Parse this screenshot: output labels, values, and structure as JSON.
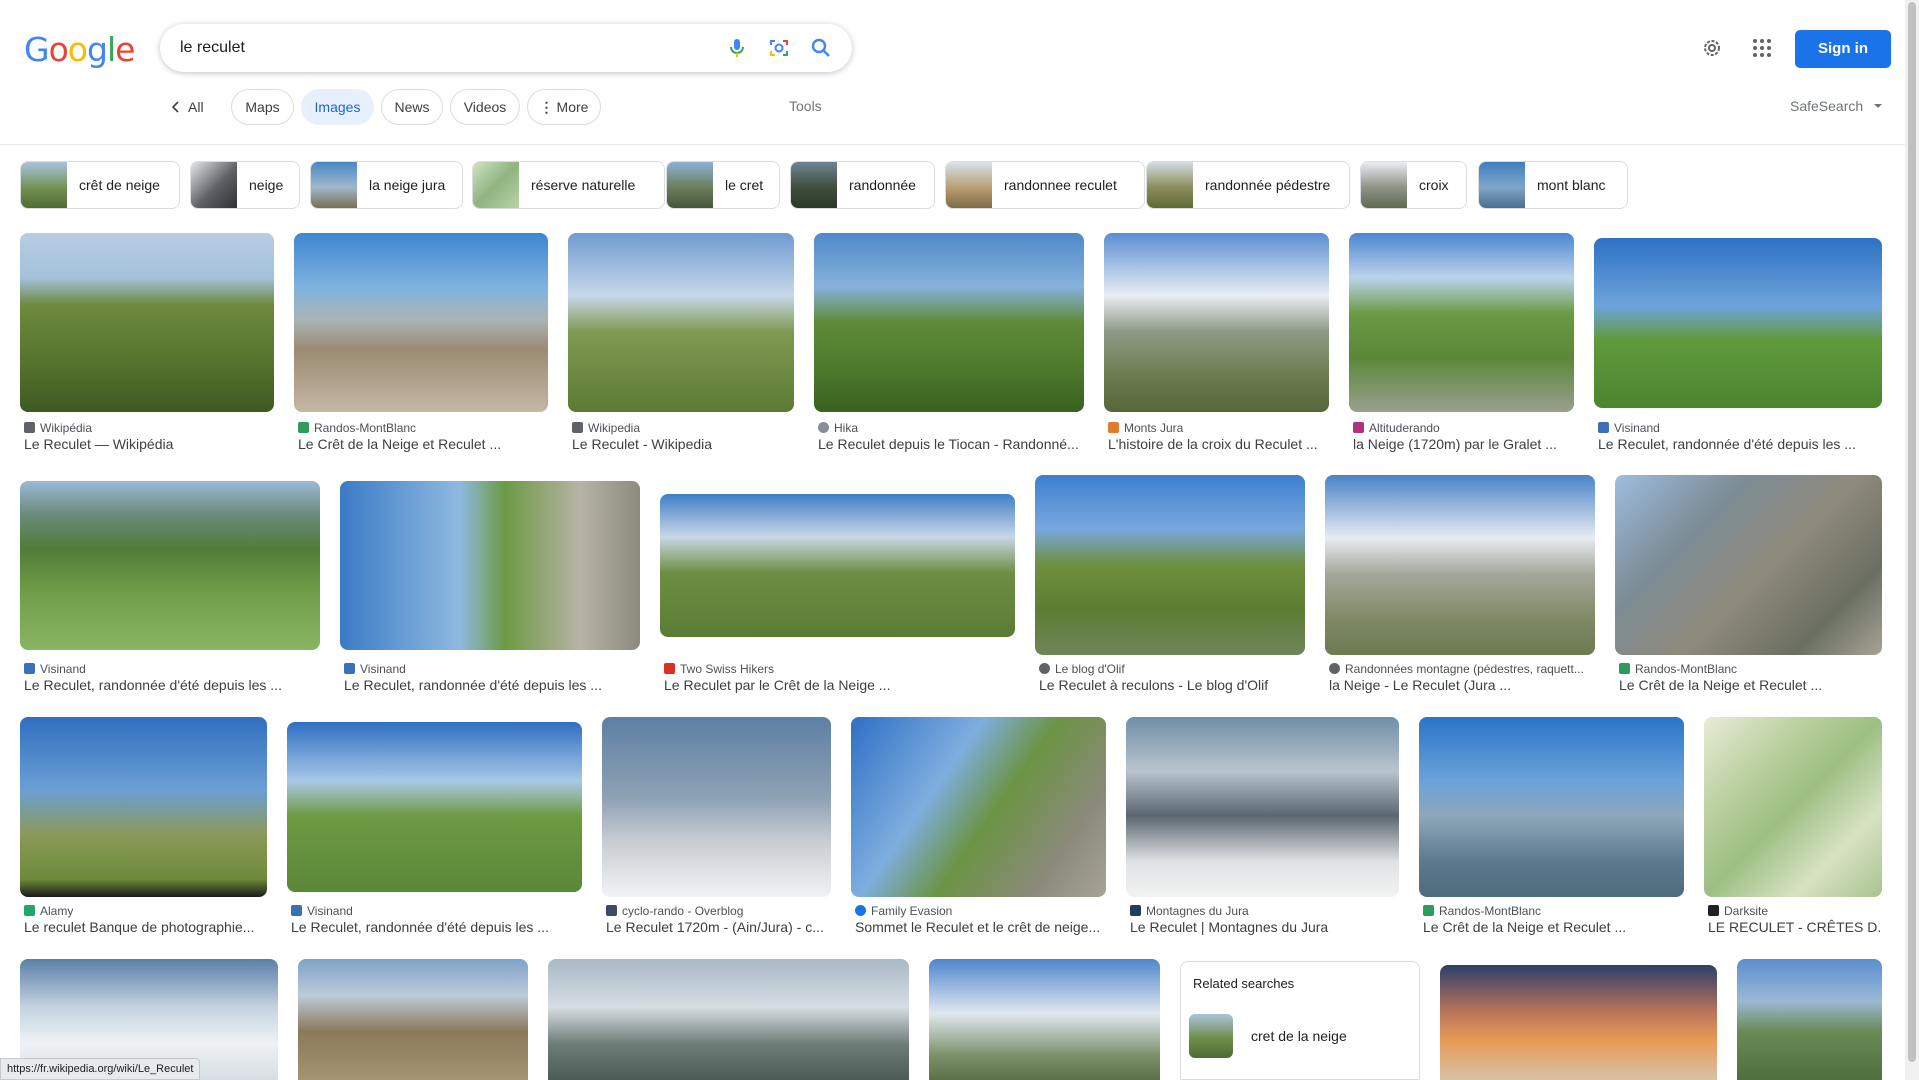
{
  "logo": "Google",
  "search": {
    "query": "le reculet",
    "placeholder": ""
  },
  "header": {
    "signin_label": "Sign in"
  },
  "tabs": {
    "all": "All",
    "items": [
      "Maps",
      "Images",
      "News",
      "Videos",
      "More"
    ],
    "active": "Images",
    "tools": "Tools",
    "safesearch": "SafeSearch"
  },
  "chips": [
    "crêt de neige",
    "neige",
    "la neige jura",
    "réserve naturelle",
    "le cret",
    "randonnée",
    "randonnee reculet",
    "randonnée pédestre",
    "croix",
    "mont blanc"
  ],
  "results": [
    {
      "source": "Wikipédia",
      "title": "Le Reculet — Wikipédia"
    },
    {
      "source": "Randos-MontBlanc",
      "title": "Le Crêt de la Neige et Reculet ..."
    },
    {
      "source": "Wikipedia",
      "title": "Le Reculet - Wikipedia"
    },
    {
      "source": "Hika",
      "title": "Le Reculet depuis le Tiocan - Randonné..."
    },
    {
      "source": "Monts Jura",
      "title": "L'histoire de la croix du Reculet ..."
    },
    {
      "source": "Altituderando",
      "title": "la Neige (1720m) par le Gralet ..."
    },
    {
      "source": "Visinand",
      "title": "Le Reculet, randonnée d'été depuis les ..."
    },
    {
      "source": "Visinand",
      "title": "Le Reculet, randonnée d'été depuis les ..."
    },
    {
      "source": "Visinand",
      "title": "Le Reculet, randonnée d'été depuis les ..."
    },
    {
      "source": "Two Swiss Hikers",
      "title": "Le Reculet par le Crêt de la Neige ..."
    },
    {
      "source": "Le blog d'Olif",
      "title": "Le Reculet à reculons - Le blog d'Olif"
    },
    {
      "source": "Randonnées montagne (pédestres, raquett...",
      "title": "la Neige - Le Reculet (Jura ..."
    },
    {
      "source": "Randos-MontBlanc",
      "title": "Le Crêt de la Neige et Reculet ..."
    },
    {
      "source": "Alamy",
      "title": "Le reculet Banque de photographie..."
    },
    {
      "source": "Visinand",
      "title": "Le Reculet, randonnée d'été depuis les ..."
    },
    {
      "source": "cyclo-rando - Overblog",
      "title": "Le Reculet 1720m - (Ain/Jura) - c..."
    },
    {
      "source": "Family Evasion",
      "title": "Sommet le Reculet et le crêt de neige..."
    },
    {
      "source": "Montagnes du Jura",
      "title": "Le Reculet | Montagnes du Jura"
    },
    {
      "source": "Randos-MontBlanc",
      "title": "Le Crêt de la Neige et Reculet ..."
    },
    {
      "source": "Darksite",
      "title": "LE RECULET - CRÊTES D..."
    }
  ],
  "related": {
    "heading": "Related searches",
    "first": "cret de la neige"
  },
  "statusbar": "https://fr.wikipedia.org/wiki/Le_Reculet",
  "colors": {
    "accent": "#1a73e8",
    "active_tab_bg": "#e8f0fe",
    "active_tab_text": "#1967d2"
  }
}
